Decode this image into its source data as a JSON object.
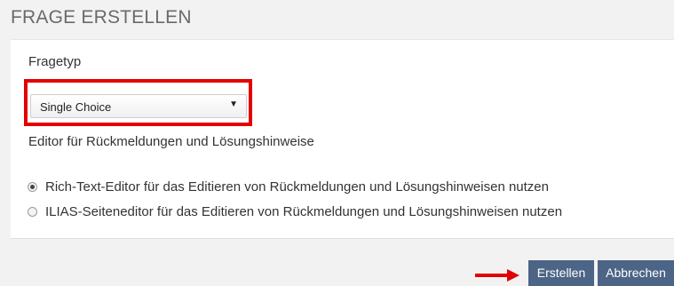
{
  "header": {
    "title": "FRAGE ERSTELLEN"
  },
  "form": {
    "question_type_label": "Fragetyp",
    "question_type_value": "Single Choice",
    "editor_label": "Editor für Rückmeldungen und Lösungshinweise",
    "editor_options": [
      {
        "label": "Rich-Text-Editor für das Editieren von Rückmeldungen und Lösungshinweisen nutzen",
        "selected": true
      },
      {
        "label": "ILIAS-Seiteneditor für das Editieren von Rückmeldungen und Lösungshinweisen nutzen",
        "selected": false
      }
    ]
  },
  "buttons": {
    "create_label": "Erstellen",
    "cancel_label": "Abbrechen"
  },
  "annotations": {
    "highlight_color": "#e30000",
    "arrow_color": "#e30000"
  },
  "colors": {
    "button_bg": "#4c6586",
    "page_bg": "#f2f2f2",
    "panel_bg": "#ffffff"
  }
}
